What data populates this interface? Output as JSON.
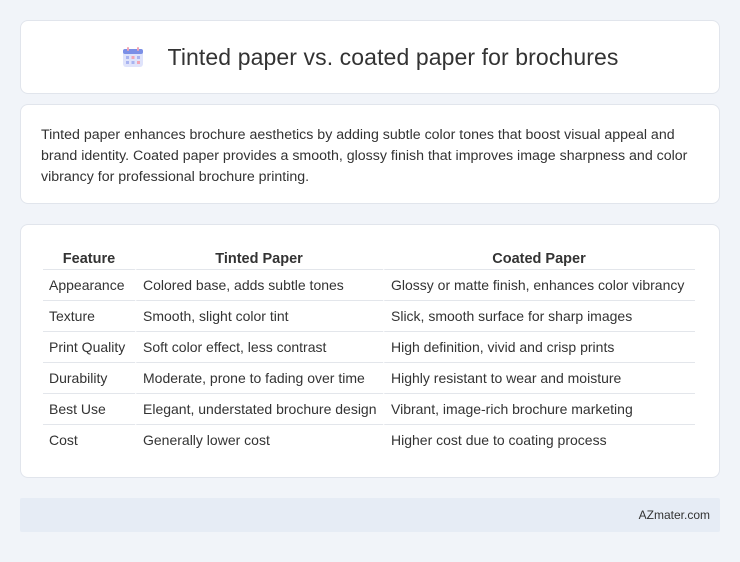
{
  "header": {
    "title": "Tinted paper vs. coated paper for brochures",
    "icon": "calendar-icon"
  },
  "intro": {
    "text": "Tinted paper enhances brochure aesthetics by adding subtle color tones that boost visual appeal and brand identity. Coated paper provides a smooth, glossy finish that improves image sharpness and color vibrancy for professional brochure printing."
  },
  "table": {
    "headers": [
      "Feature",
      "Tinted Paper",
      "Coated Paper"
    ],
    "rows": [
      [
        "Appearance",
        "Colored base, adds subtle tones",
        "Glossy or matte finish, enhances color vibrancy"
      ],
      [
        "Texture",
        "Smooth, slight color tint",
        "Slick, smooth surface for sharp images"
      ],
      [
        "Print Quality",
        "Soft color effect, less contrast",
        "High definition, vivid and crisp prints"
      ],
      [
        "Durability",
        "Moderate, prone to fading over time",
        "Highly resistant to wear and moisture"
      ],
      [
        "Best Use",
        "Elegant, understated brochure design",
        "Vibrant, image-rich brochure marketing"
      ],
      [
        "Cost",
        "Generally lower cost",
        "Higher cost due to coating process"
      ]
    ]
  },
  "footer": {
    "credit": "AZmater.com"
  }
}
